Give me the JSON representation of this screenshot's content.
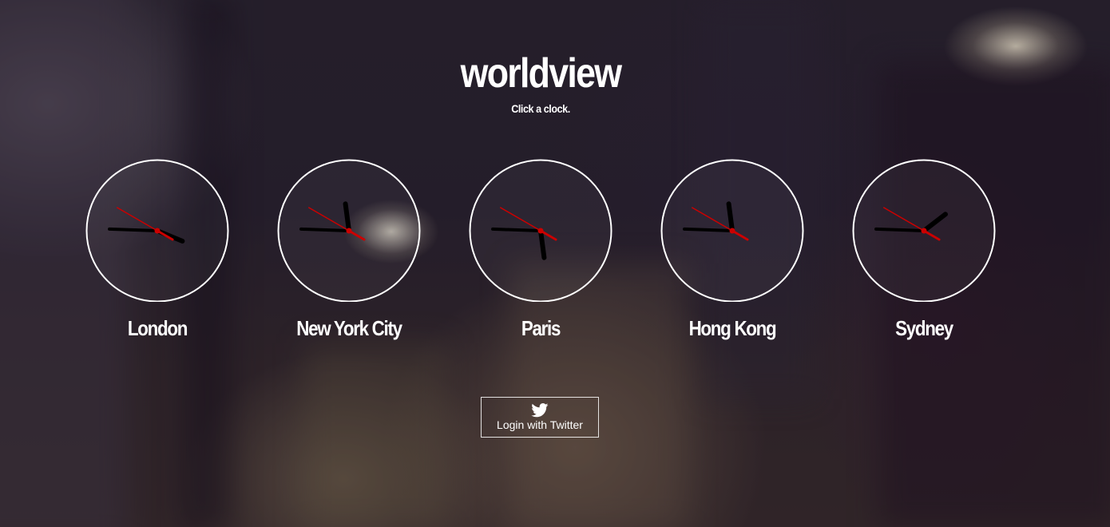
{
  "app": {
    "title": "worldview",
    "subtitle": "Click a clock."
  },
  "clocks": [
    {
      "city": "London",
      "time": "3:45:20"
    },
    {
      "city": "New York City",
      "time": "11:45:20"
    },
    {
      "city": "Paris",
      "time": "5:45:20"
    },
    {
      "city": "Hong Kong",
      "time": "11:45:20"
    },
    {
      "city": "Sydney",
      "time": "1:45:20"
    }
  ],
  "clock_style": {
    "face_border_color": "#ffffff",
    "hand_color": "#000000",
    "second_hand_color": "#cc0000"
  },
  "auth": {
    "login_label": "Login with Twitter",
    "icon": "twitter-bird-icon"
  }
}
